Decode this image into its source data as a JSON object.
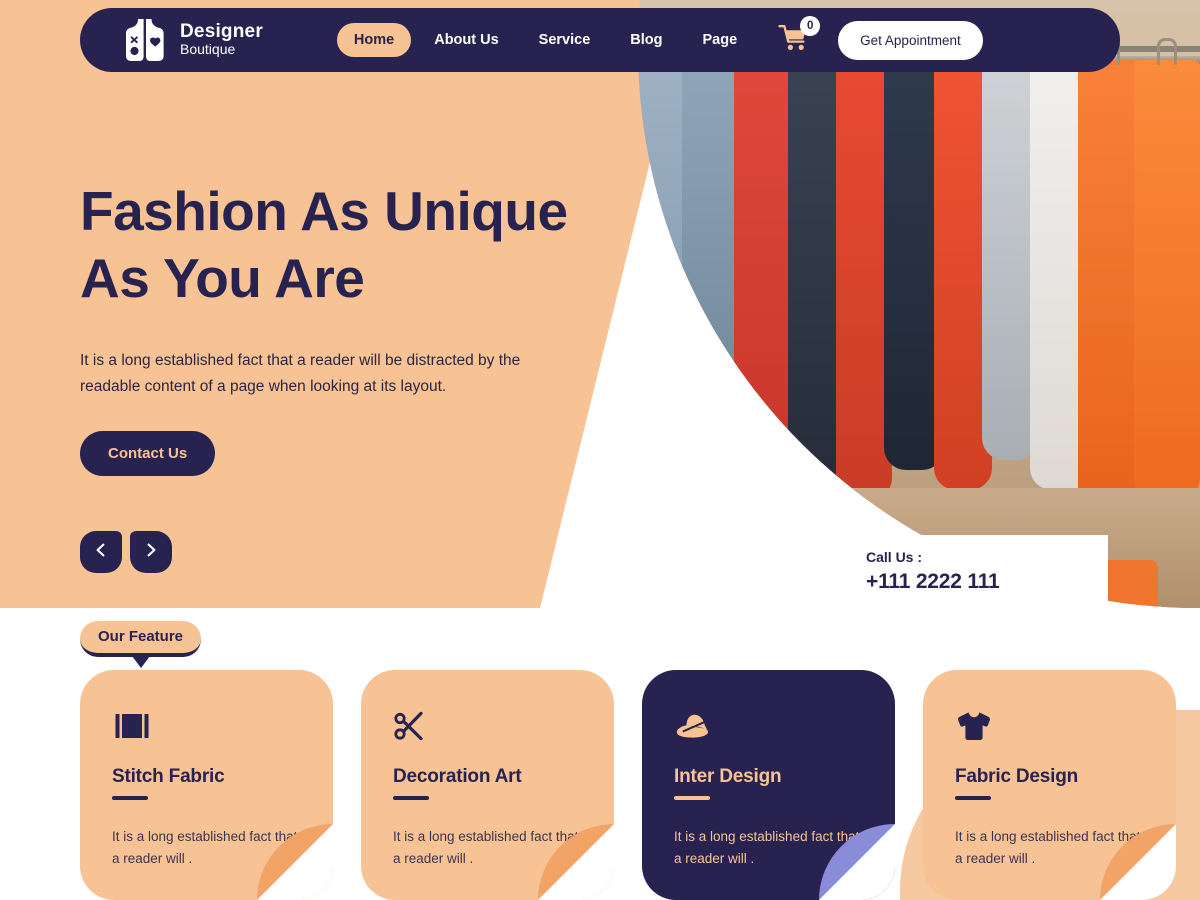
{
  "navbar": {
    "brand": {
      "title": "Designer",
      "subtitle": "Boutique",
      "icon": "vest-icon"
    },
    "links": [
      {
        "label": "Home",
        "active": true
      },
      {
        "label": "About Us",
        "active": false
      },
      {
        "label": "Service",
        "active": false
      },
      {
        "label": "Blog",
        "active": false
      },
      {
        "label": "Page",
        "active": false
      }
    ],
    "cart": {
      "icon": "shopping-cart-icon",
      "count": "0"
    },
    "appointment_button": "Get Appointment"
  },
  "hero": {
    "title_line1": "Fashion As Unique",
    "title_line2": "As You Are",
    "description": "It is a long established fact that a reader will be distracted by the readable content of a page when looking at its layout.",
    "cta_label": "Contact Us",
    "prev_icon": "chevron-left-icon",
    "next_icon": "chevron-right-icon",
    "call_label": "Call Us :",
    "call_number": "+111 2222 111"
  },
  "features": {
    "badge": "Our Feature",
    "cards": [
      {
        "icon": "fabric-swatch-icon",
        "title": "Stitch Fabric",
        "description": "It is a long established fact that a reader will .",
        "theme": "peach",
        "fold_color": "#f2a366"
      },
      {
        "icon": "scissors-icon",
        "title": "Decoration Art",
        "description": "It is a long established fact that a reader will .",
        "theme": "peach",
        "fold_color": "#f2a366"
      },
      {
        "icon": "hat-icon",
        "title": "Inter Design",
        "description": "It is a long established fact that a reader will .",
        "theme": "navy",
        "fold_color": "#8b8cd9"
      },
      {
        "icon": "tshirt-icon",
        "title": "Fabric Design",
        "description": "It is a long established fact that a reader will .",
        "theme": "peach",
        "fold_color": "#f2a366"
      }
    ]
  },
  "colors": {
    "navy": "#27224f",
    "peach": "#f7c394",
    "fold_orange": "#f2a366",
    "fold_periwinkle": "#8b8cd9",
    "white": "#ffffff"
  }
}
